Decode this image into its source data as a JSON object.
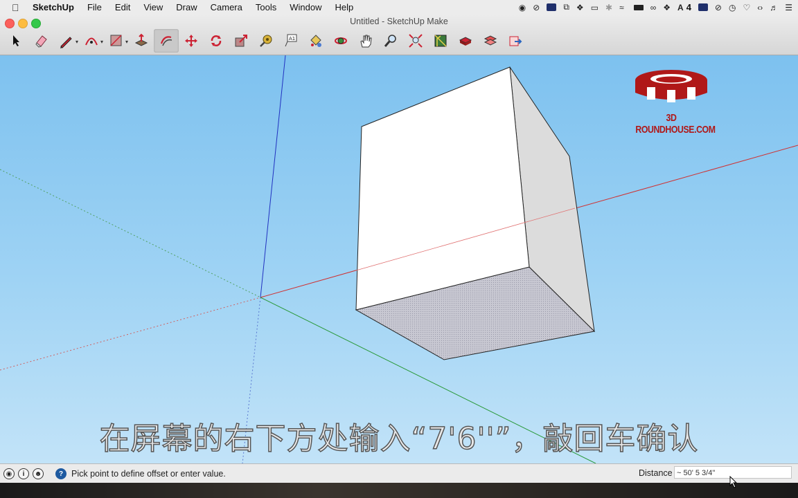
{
  "menubar": {
    "apple_icon": "apple-icon",
    "items": [
      "SketchUp",
      "File",
      "Edit",
      "View",
      "Draw",
      "Camera",
      "Tools",
      "Window",
      "Help"
    ],
    "status_text": "4"
  },
  "window": {
    "title": "Untitled - SketchUp Make"
  },
  "toolbar": {
    "tools": [
      "select",
      "eraser",
      "line",
      "arc",
      "rectangle",
      "push-pull",
      "offset",
      "move",
      "rotate",
      "scale",
      "tape-measure",
      "text",
      "paint-bucket",
      "orbit",
      "pan",
      "zoom",
      "zoom-extents",
      "3d-warehouse",
      "extension-warehouse",
      "layout",
      "send-to-layout"
    ],
    "active_tool": "offset"
  },
  "overlay": {
    "logo_text": "3D ROUNDHOUSE.COM",
    "subtitle": "在屏幕的右下方处输入“7'6''”，敲回车确认",
    "accent_color": "#b01818"
  },
  "statusbar": {
    "message": "Pick point to define offset or enter value.",
    "measure_label": "Distance",
    "measure_value": "~ 50' 5 3/4\""
  }
}
